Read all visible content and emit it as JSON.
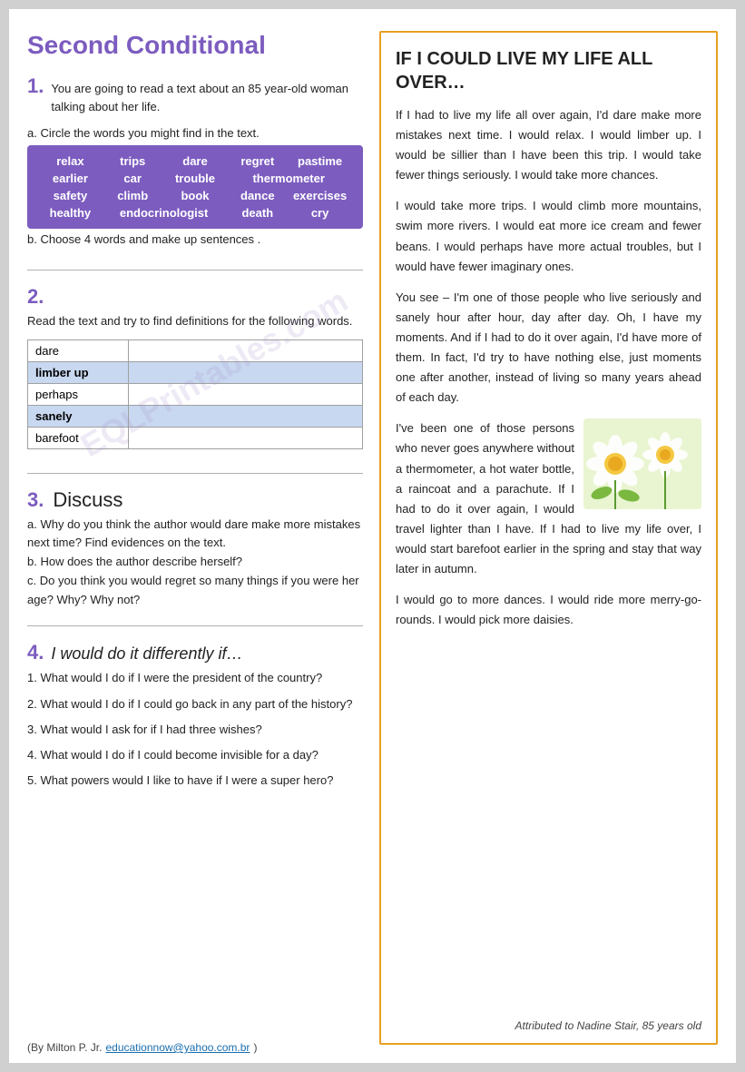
{
  "page": {
    "title": "Second Conditional",
    "watermark": "EQLPrintab...",
    "footer": {
      "text": "(By Milton P. Jr. ",
      "email": "educationnow@yahoo.com.br",
      "closing": ")"
    }
  },
  "left": {
    "section1": {
      "number": "1.",
      "text": "You are going to read a text about an 85 year-old woman talking about her life."
    },
    "part_a_label": "a. Circle the words you might find in the text.",
    "words": [
      "relax",
      "trips",
      "dare",
      "regret",
      "pastime",
      "earlier",
      "car",
      "trouble",
      "thermometer",
      "safety",
      "climb",
      "book",
      "dance",
      "exercises",
      "healthy",
      "endocrinologist",
      "death",
      "cry"
    ],
    "part_b_label": "b. Choose 4 words and make up  sentences .",
    "section2": {
      "number": "2.",
      "text": "Read the text and try to find definitions for the following words."
    },
    "definitions": [
      {
        "word": "dare",
        "bg": "white"
      },
      {
        "word": "limber up",
        "bg": "blue"
      },
      {
        "word": "perhaps",
        "bg": "white"
      },
      {
        "word": "sanely",
        "bg": "blue"
      },
      {
        "word": "barefoot",
        "bg": "white"
      }
    ],
    "section3": {
      "number": "3.",
      "title": "Discuss",
      "questions": [
        "a. Why do you think the author would dare make more mistakes next time? Find evidences on the text.",
        "b. How does the author describe herself?",
        "c. Do you think you would regret so many things if you were her age? Why? Why not?"
      ]
    },
    "section4": {
      "number": "4.",
      "title": "I would do it differently if…",
      "questions": [
        "1. What would I do if I were the president of the country?",
        "2. What would I do if I could go back in any part of the history?",
        "3. What would I ask for if I had three wishes?",
        "4. What would I do if I could become invisible for a day?",
        "5. What powers would I like to have if I were a super hero?"
      ]
    }
  },
  "right": {
    "article": {
      "title": "IF I COULD LIVE MY LIFE ALL OVER…",
      "paragraphs": [
        "If I had to live my life all over again, I'd dare make more mistakes next time. I would relax. I would limber up. I would be sillier than I have been this trip. I would take fewer things seriously. I would take more chances.",
        "I would take more trips. I would climb more mountains, swim more rivers. I would eat more ice cream and fewer beans. I would perhaps have more actual troubles, but I would have fewer imaginary ones.",
        "You see – I'm one of those people who live seriously and sanely hour after hour, day after day. Oh, I have my moments. And if I had to do it over again, I'd have more of them. In fact, I'd try to have nothing else, just moments one after another, instead of living so many years ahead of each day.",
        "I've been one of those persons who never goes anywhere without a thermometer, a hot water bottle, a raincoat and a parachute. If I had to do it over again, I would travel lighter than I have. If I had to live my life over, I would start barefoot earlier in the spring and stay that way later in autumn.",
        "I would go to more dances. I would ride more merry-go-rounds. I would pick more daisies."
      ],
      "attribution": "Attributed to Nadine Stair, 85 years old"
    }
  }
}
